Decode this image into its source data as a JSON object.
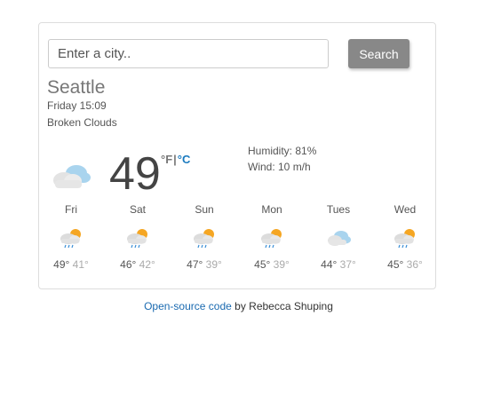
{
  "search": {
    "placeholder": "Enter a city..",
    "button_label": "Search"
  },
  "current": {
    "city": "Seattle",
    "datetime": "Friday 15:09",
    "description": "Broken Clouds",
    "icon": "cloudy-icon",
    "temp": "49",
    "unit_f": "°F",
    "unit_sep": "|",
    "unit_c": "°C",
    "humidity": "Humidity: 81%",
    "wind": "Wind: 10 m/h"
  },
  "forecast": [
    {
      "day": "Fri",
      "icon": "rain-sun-icon",
      "high": "49°",
      "low": "41°"
    },
    {
      "day": "Sat",
      "icon": "rain-sun-icon",
      "high": "46°",
      "low": "42°"
    },
    {
      "day": "Sun",
      "icon": "rain-sun-icon",
      "high": "47°",
      "low": "39°"
    },
    {
      "day": "Mon",
      "icon": "rain-sun-icon",
      "high": "45°",
      "low": "39°"
    },
    {
      "day": "Tues",
      "icon": "cloudy-icon",
      "high": "44°",
      "low": "37°"
    },
    {
      "day": "Wed",
      "icon": "rain-sun-icon",
      "high": "45°",
      "low": "36°"
    }
  ],
  "footer": {
    "link_text": "Open-source code",
    "credit": "by Rebecca Shuping"
  },
  "colors": {
    "button": "#888888",
    "link": "#1a6ab0",
    "temp": "#444444",
    "cloud_blue": "#a9d4ee",
    "sun": "#f5a623"
  }
}
